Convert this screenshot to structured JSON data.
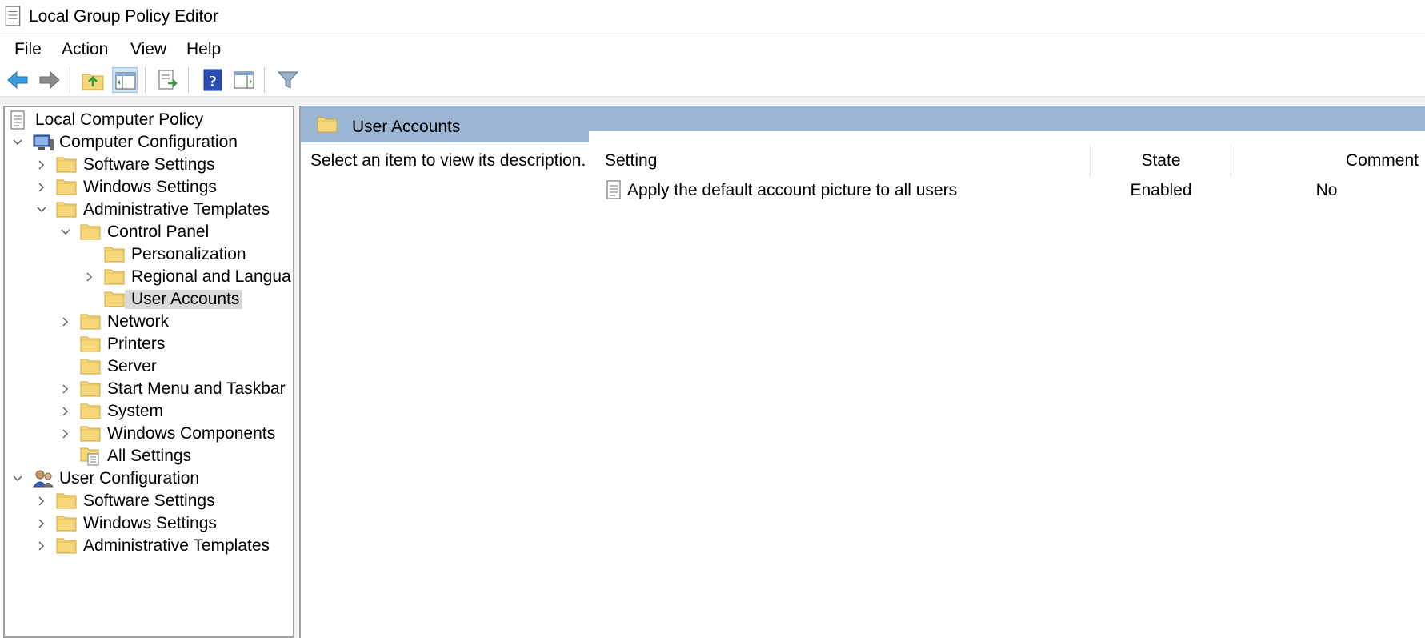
{
  "window": {
    "title": "Local Group Policy Editor"
  },
  "menu": [
    "File",
    "Action",
    "View",
    "Help"
  ],
  "toolbar": {
    "buttons": [
      "back-icon",
      "forward-icon",
      "up-one-level-icon",
      "show-hide-console-tree-icon",
      "export-list-icon",
      "help-icon",
      "show-hide-action-pane-icon",
      "filter-icon"
    ]
  },
  "tree": {
    "root": "Local Computer Policy",
    "computer_configuration": "Computer Configuration",
    "cc_software_settings": "Software Settings",
    "cc_windows_settings": "Windows Settings",
    "cc_administrative_templates": "Administrative Templates",
    "control_panel": "Control Panel",
    "personalization": "Personalization",
    "regional": "Regional and Langua",
    "user_accounts": "User Accounts",
    "network": "Network",
    "printers": "Printers",
    "server": "Server",
    "start_menu": "Start Menu and Taskbar",
    "system": "System",
    "windows_components": "Windows Components",
    "all_settings": "All Settings",
    "user_configuration": "User Configuration",
    "uc_software_settings": "Software Settings",
    "uc_windows_settings": "Windows Settings",
    "uc_administrative_templates": "Administrative Templates"
  },
  "main": {
    "header_title": "User Accounts",
    "description": "Select an item to view its description.",
    "columns": {
      "setting": "Setting",
      "state": "State",
      "comment": "Comment"
    },
    "rows": [
      {
        "setting": "Apply the default account picture to all users",
        "state": "Enabled",
        "comment": "No"
      }
    ]
  },
  "colors": {
    "header_band": "#9bb6d3",
    "selection": "#d9d9d9",
    "folder": "#f6d77a"
  }
}
